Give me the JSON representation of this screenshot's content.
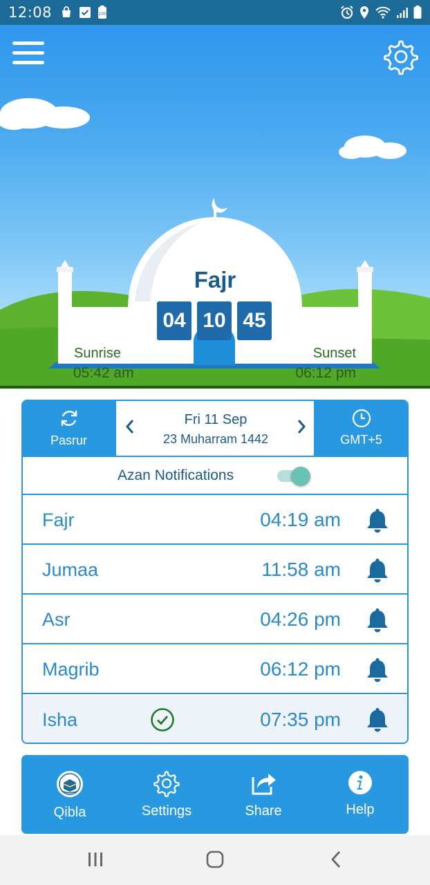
{
  "status_bar": {
    "time": "12:08",
    "left_icons": [
      "shopping-bag-icon",
      "checkbox-icon",
      "battery-saver-icon"
    ],
    "right_icons": [
      "alarm-icon",
      "location-icon",
      "wifi-icon",
      "signal-icon",
      "battery-icon"
    ]
  },
  "hero": {
    "menu_icon": "hamburger-menu-icon",
    "settings_icon": "gear-icon",
    "next_prayer": "Fajr",
    "countdown": {
      "hours": "04",
      "minutes": "10",
      "seconds": "45"
    },
    "sunrise": {
      "label": "Sunrise",
      "time": "05:42 am"
    },
    "sunset": {
      "label": "Sunset",
      "time": "06:12 pm"
    }
  },
  "panel": {
    "city_tab": {
      "icon": "refresh-icon",
      "label": "Pasrur"
    },
    "timezone_tab": {
      "icon": "clock-icon",
      "label": "GMT+5"
    },
    "date": {
      "gregorian": "Fri 11 Sep",
      "hijri": "23 Muharram 1442"
    },
    "azan": {
      "label": "Azan Notifications",
      "enabled": true
    },
    "prayers": [
      {
        "name": "Fajr",
        "time": "04:19 am",
        "current": false
      },
      {
        "name": "Jumaa",
        "time": "11:58 am",
        "current": false
      },
      {
        "name": "Asr",
        "time": "04:26 pm",
        "current": false
      },
      {
        "name": "Magrib",
        "time": "06:12 pm",
        "current": false
      },
      {
        "name": "Isha",
        "time": "07:35 pm",
        "current": true
      }
    ]
  },
  "bottom_bar": {
    "items": [
      {
        "label": "Qibla",
        "icon": "kaaba-icon"
      },
      {
        "label": "Settings",
        "icon": "gear-icon"
      },
      {
        "label": "Share",
        "icon": "share-icon"
      },
      {
        "label": "Help",
        "icon": "info-icon"
      }
    ]
  },
  "colors": {
    "primary": "#2899e0",
    "dark_blue": "#1c6a98",
    "countdown_bg": "#1f6aa8",
    "grass": "#5cb52e"
  }
}
